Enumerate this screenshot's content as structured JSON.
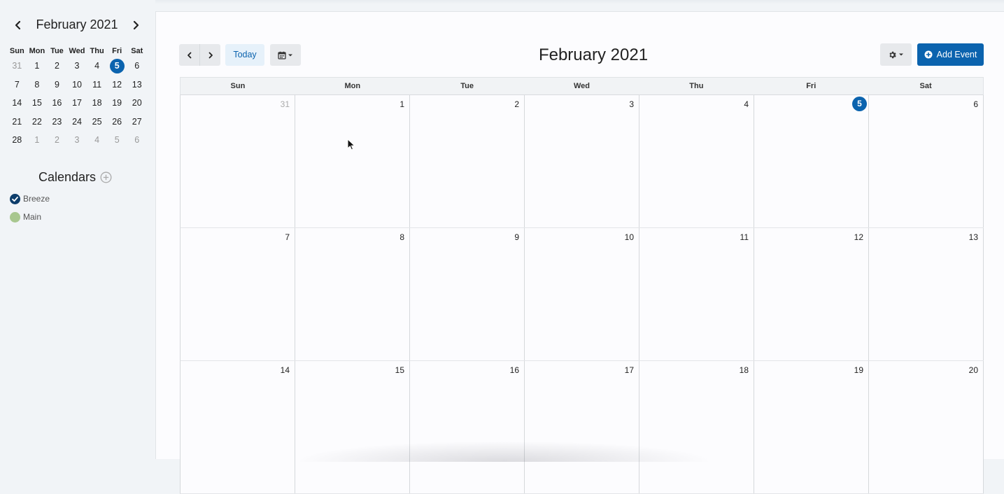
{
  "mini_calendar": {
    "title": "February 2021",
    "weekdays": [
      "Sun",
      "Mon",
      "Tue",
      "Wed",
      "Thu",
      "Fri",
      "Sat"
    ],
    "weeks": [
      [
        "31",
        "1",
        "2",
        "3",
        "4",
        "5",
        "6"
      ],
      [
        "7",
        "8",
        "9",
        "10",
        "11",
        "12",
        "13"
      ],
      [
        "14",
        "15",
        "16",
        "17",
        "18",
        "19",
        "20"
      ],
      [
        "21",
        "22",
        "23",
        "24",
        "25",
        "26",
        "27"
      ],
      [
        "28",
        "1",
        "2",
        "3",
        "4",
        "5",
        "6"
      ]
    ],
    "today": "5"
  },
  "calendars": {
    "title": "Calendars",
    "items": [
      {
        "label": "Breeze",
        "color": "#0d3d6b",
        "checked": true
      },
      {
        "label": "Main",
        "color": "#a8c78f",
        "checked": false
      }
    ]
  },
  "toolbar": {
    "today_label": "Today",
    "title": "February 2021",
    "add_event_label": "Add Event"
  },
  "month_view": {
    "weekdays": [
      "Sun",
      "Mon",
      "Tue",
      "Wed",
      "Thu",
      "Fri",
      "Sat"
    ],
    "weeks": [
      [
        "31",
        "1",
        "2",
        "3",
        "4",
        "5",
        "6"
      ],
      [
        "7",
        "8",
        "9",
        "10",
        "11",
        "12",
        "13"
      ],
      [
        "14",
        "15",
        "16",
        "17",
        "18",
        "19",
        "20"
      ]
    ],
    "today": "5"
  },
  "colors": {
    "accent": "#0b63ae",
    "sidebar_bg": "#f1f4f7"
  }
}
